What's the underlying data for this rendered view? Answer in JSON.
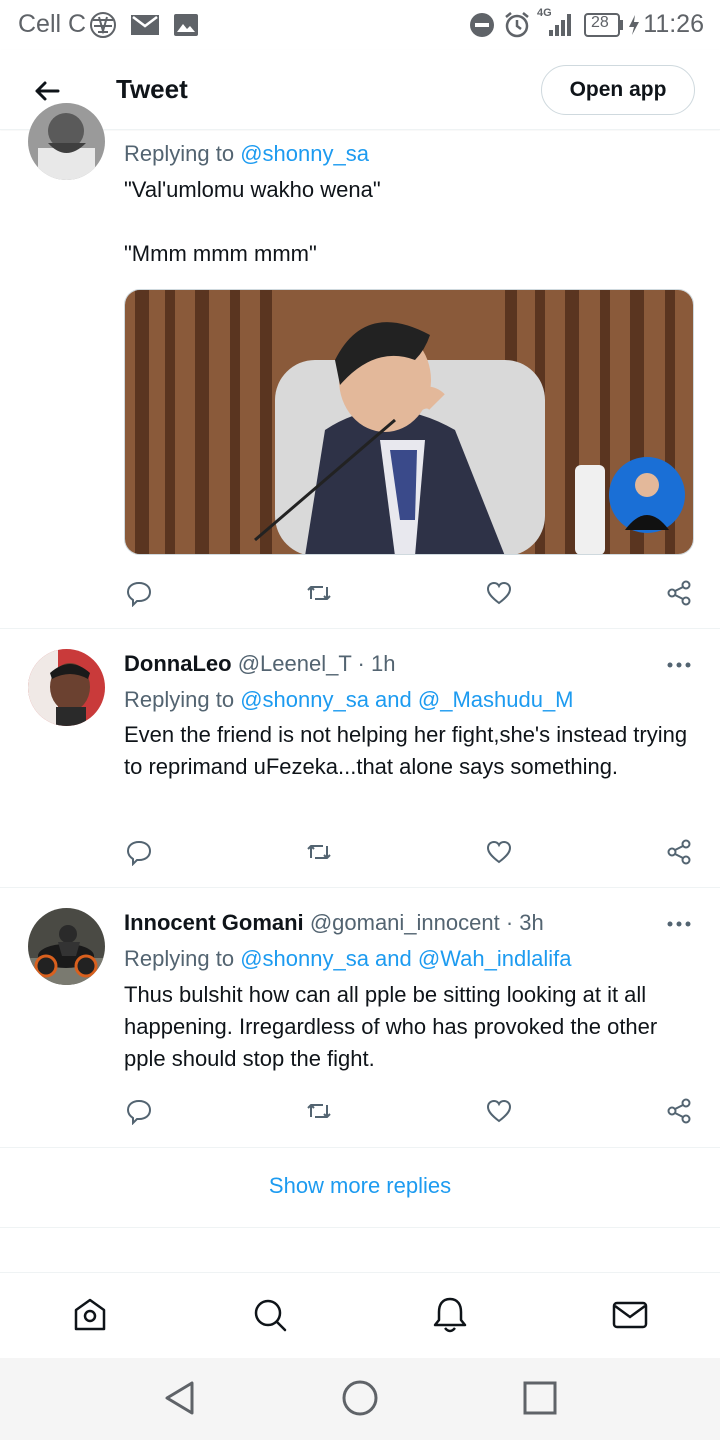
{
  "status_bar": {
    "carrier": "Cell C",
    "network": "4G",
    "battery": "28",
    "time": "11:26",
    "icons": [
      "vodacom-logo-icon",
      "mail-icon",
      "image-icon",
      "do-not-disturb-icon",
      "alarm-icon",
      "signal-icon",
      "battery-icon",
      "charging-icon"
    ]
  },
  "header": {
    "title": "Tweet",
    "open_app_label": "Open app"
  },
  "tweets": [
    {
      "replying_prefix": "Replying to",
      "mentions": "@shonny_sa",
      "text_line1": "\"Val'umlomu wakho wena\"",
      "text_line2": "\"Mmm mmm mmm\"",
      "has_media": true
    },
    {
      "name": "DonnaLeo",
      "handle": "@Leenel_T",
      "dot": "·",
      "time": "1h",
      "replying_prefix": "Replying to",
      "mentions": "@shonny_sa and @_Mashudu_M",
      "text": "Even the friend is not helping her fight,she's instead trying to reprimand uFezeka...that alone says something."
    },
    {
      "name": "Innocent Gomani",
      "handle": "@gomani_innocent",
      "dot": "·",
      "time": "3h",
      "replying_prefix": "Replying to",
      "mentions": "@shonny_sa and @Wah_indlalifa",
      "text": "Thus bulshit how can all pple be sitting looking at it all happening. Irregardless of who has provoked the other pple should stop the fight."
    }
  ],
  "show_more_label": "Show more replies",
  "tabbar": [
    "home-icon",
    "search-icon",
    "notifications-icon",
    "messages-icon"
  ],
  "navbar": [
    "back-icon",
    "home-icon",
    "recents-icon"
  ],
  "colors": {
    "accent": "#1d9bf0",
    "text": "#0f1419",
    "secondary": "#536471",
    "divider": "#eff3f4"
  }
}
